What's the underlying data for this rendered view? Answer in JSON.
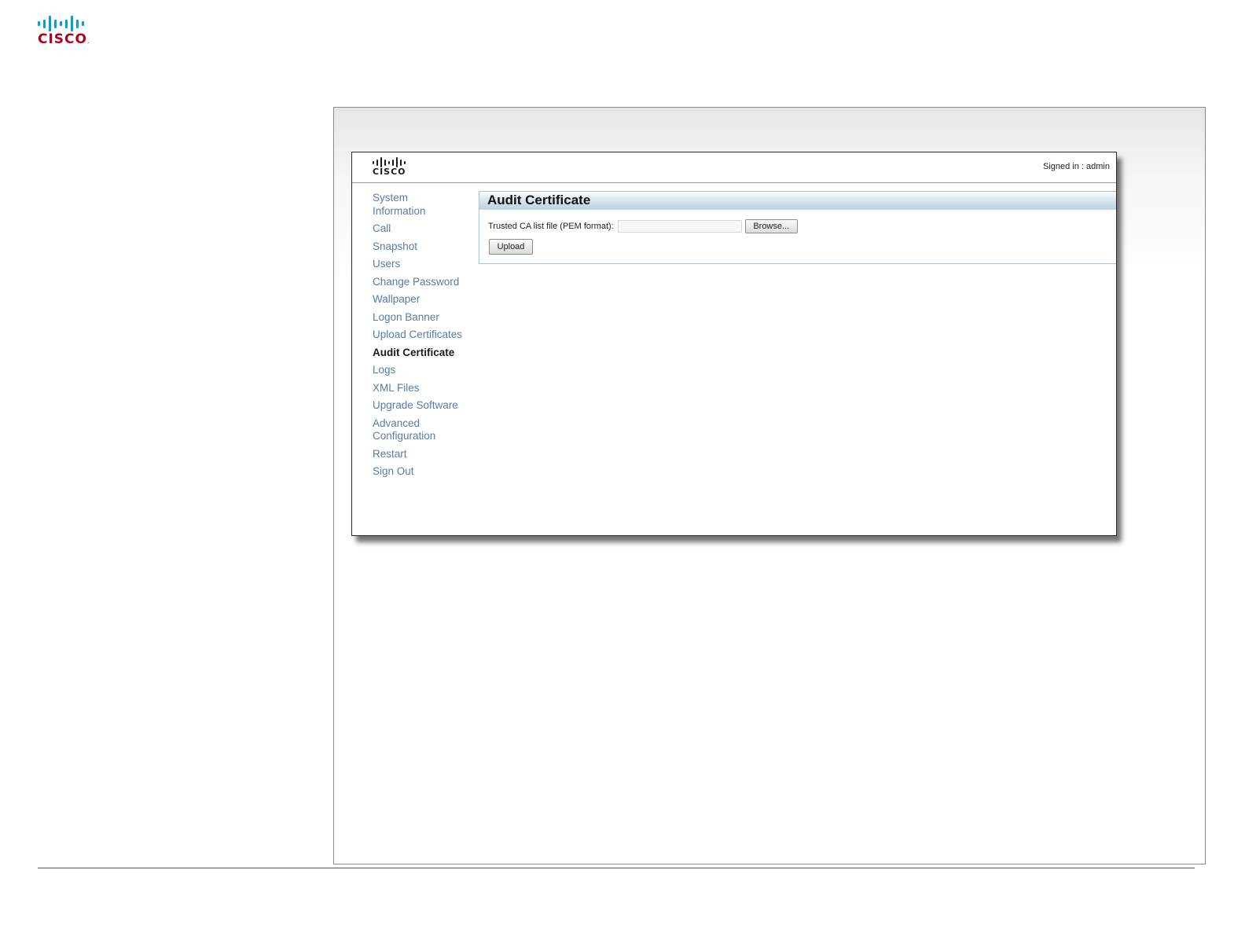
{
  "brand": {
    "word": "CISCO",
    "tm": ".",
    "logo_color": "#b0001f",
    "bars_color": "#049fd9"
  },
  "app": {
    "logo_word": "CISCO",
    "signed_in": "Signed in : admin",
    "nav": [
      {
        "label": "System Information",
        "active": false
      },
      {
        "label": "Call",
        "active": false
      },
      {
        "label": "Snapshot",
        "active": false
      },
      {
        "label": "Users",
        "active": false
      },
      {
        "label": "Change Password",
        "active": false
      },
      {
        "label": "Wallpaper",
        "active": false
      },
      {
        "label": "Logon Banner",
        "active": false
      },
      {
        "label": "Upload Certificates",
        "active": false
      },
      {
        "label": "Audit Certificate",
        "active": true
      },
      {
        "label": "Logs",
        "active": false
      },
      {
        "label": "XML Files",
        "active": false
      },
      {
        "label": "Upgrade Software",
        "active": false
      },
      {
        "label": "Advanced Configuration",
        "active": false
      },
      {
        "label": "Restart",
        "active": false
      },
      {
        "label": "Sign Out",
        "active": false
      }
    ],
    "panel": {
      "title": "Audit Certificate",
      "field_label": "Trusted CA list file (PEM format):",
      "file_value": "",
      "browse_label": "Browse...",
      "upload_label": "Upload"
    }
  },
  "colors": {
    "nav_link": "#5a7aa8",
    "panel_border": "#a9c3cf"
  }
}
